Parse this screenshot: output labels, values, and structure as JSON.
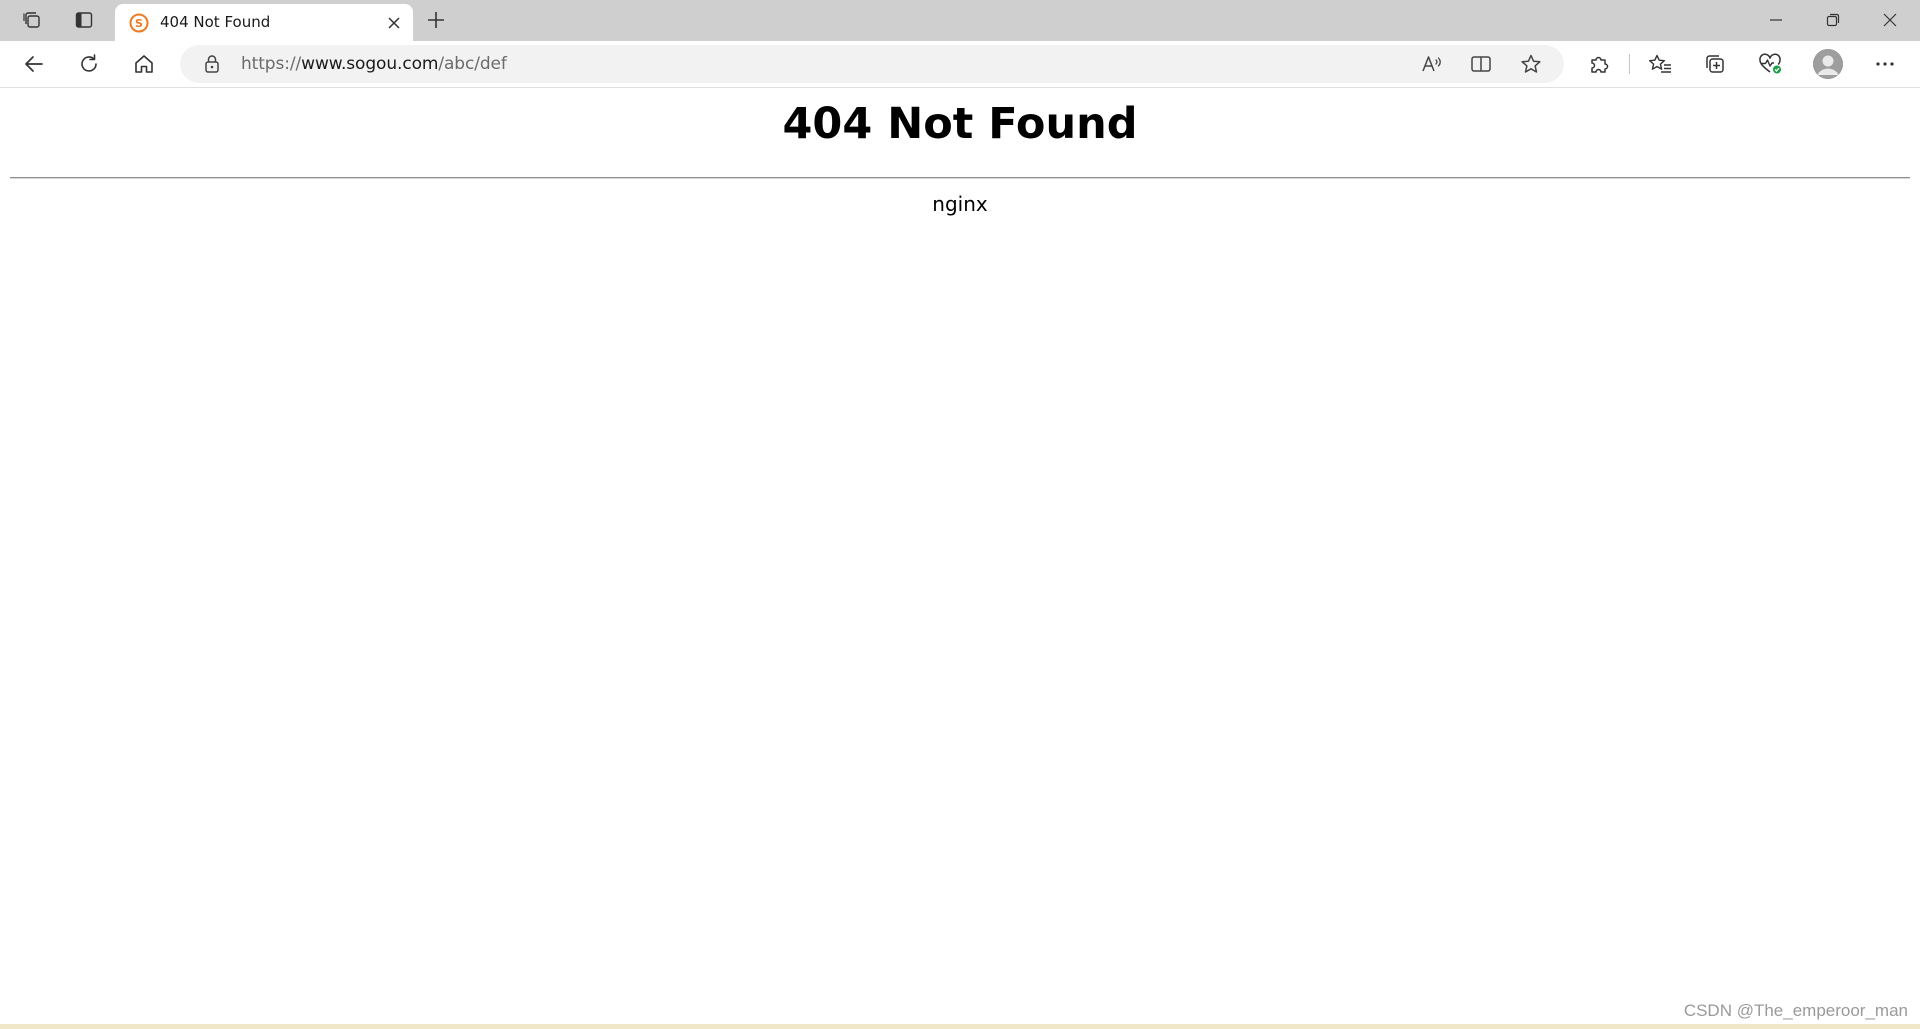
{
  "browser": {
    "tab": {
      "title": "404 Not Found",
      "favicon_color": "#ef7a22"
    },
    "address": {
      "scheme": "https://",
      "host": "www.sogou.com",
      "path": "/abc/def"
    },
    "icons": {
      "workspaces": "workspaces-icon",
      "tab_actions": "tab-actions-icon",
      "new_tab": "plus-icon",
      "back": "back-arrow-icon",
      "refresh": "refresh-icon",
      "home": "home-icon",
      "lock": "lock-icon",
      "read_aloud": "read-aloud-icon",
      "split_screen": "split-screen-icon",
      "favorite": "star-icon",
      "extensions": "puzzle-icon",
      "favorites": "favorites-list-icon",
      "collections": "collections-icon",
      "performance": "heartbeat-icon",
      "profile": "profile-avatar-icon",
      "more": "ellipsis-icon"
    }
  },
  "page": {
    "heading": "404 Not Found",
    "server": "nginx"
  },
  "watermark": "CSDN @The_emperoor_man"
}
